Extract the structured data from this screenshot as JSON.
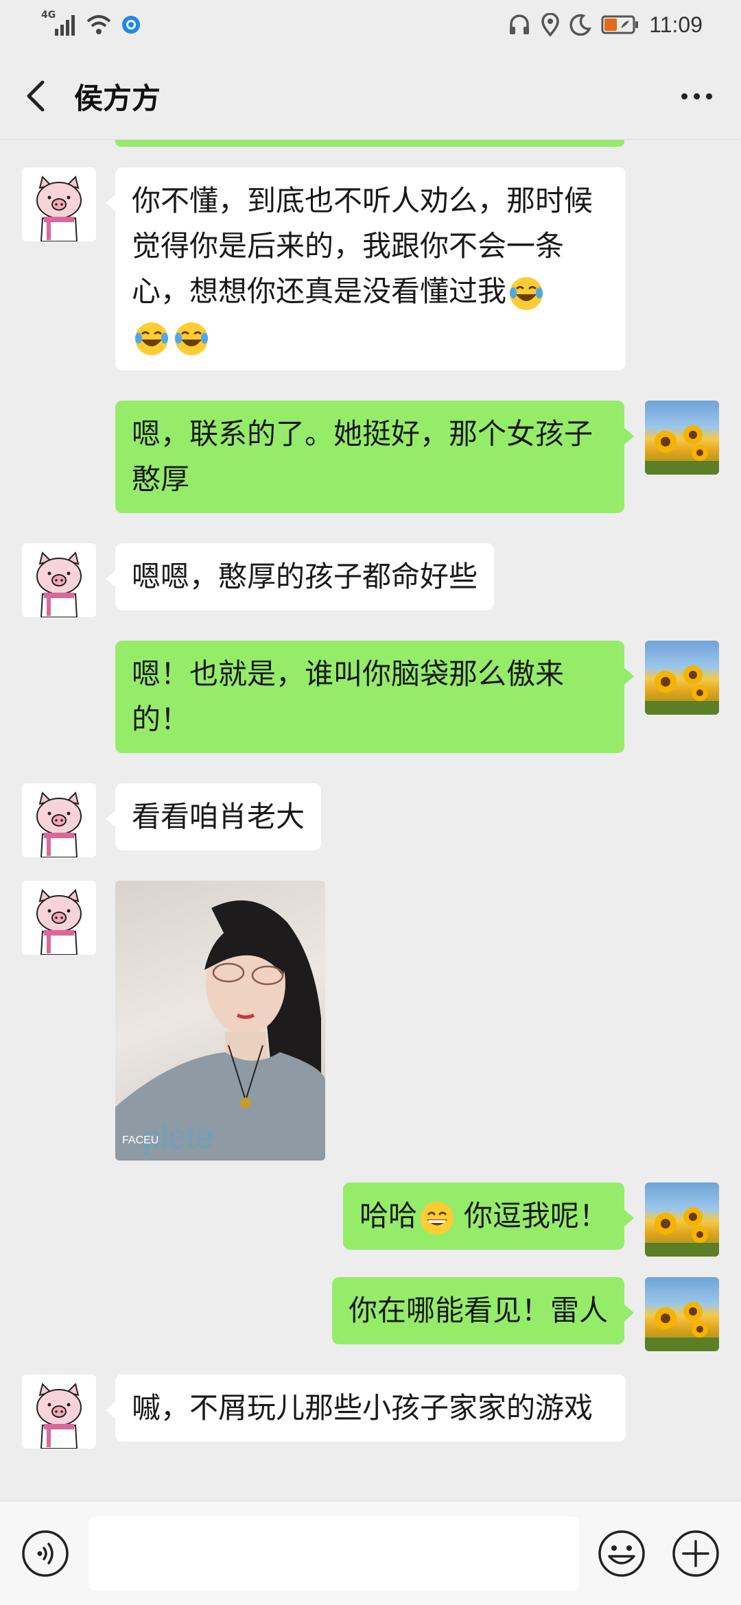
{
  "status_bar": {
    "network": "4G",
    "time": "11:09"
  },
  "header": {
    "title": "侯方方"
  },
  "messages": [
    {
      "side": "in",
      "text_parts": [
        "你不懂，到底也不听人劝么，那时候觉得你是后来的，我跟你不会一条心，想想你还真是没看懂过我"
      ],
      "emojis": "😂😂😂"
    },
    {
      "side": "out",
      "text": "嗯，联系的了。她挺好，那个女孩子憨厚"
    },
    {
      "side": "in",
      "text": "嗯嗯，憨厚的孩子都命好些"
    },
    {
      "side": "out",
      "text": "嗯！也就是，谁叫你脑袋那么傲来的！"
    },
    {
      "side": "in",
      "text": "看看咱肖老大"
    },
    {
      "side": "in",
      "type": "image",
      "watermark": "FACEU"
    },
    {
      "side": "out",
      "text_before": "哈哈",
      "emoji": "😄",
      "text_after": "你逗我呢！"
    },
    {
      "side": "out",
      "text": "你在哪能看见！雷人"
    },
    {
      "side": "in",
      "text": "嘁，不屑玩儿那些小孩子家家的游戏"
    }
  ],
  "colors": {
    "background": "#ededed",
    "outgoing_bubble": "#95ec69",
    "incoming_bubble": "#ffffff"
  }
}
